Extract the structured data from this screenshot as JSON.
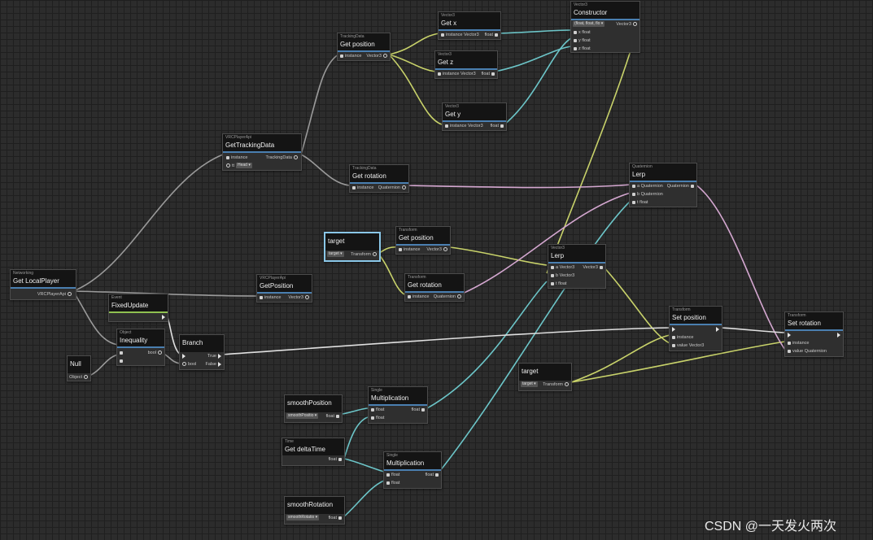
{
  "nodes": {
    "get_local_player": {
      "category": "Networking",
      "title": "Get LocalPlayer",
      "out": "VRCPlayerApi"
    },
    "get_tracking_data": {
      "category": "VRCPlayerApi",
      "title": "GetTrackingData",
      "in1": "instance",
      "in2": "tt",
      "dropdown": "Head",
      "out": "TrackingData"
    },
    "get_position_tracking": {
      "category": "TrackingData",
      "title": "Get position",
      "in": "instance",
      "out": "Vector3"
    },
    "get_x": {
      "category": "Vector3",
      "title": "Get x",
      "in": "instance",
      "in_type": "Vector3",
      "out": "float"
    },
    "get_z": {
      "category": "Vector3",
      "title": "Get z",
      "in": "instance",
      "in_type": "Vector3",
      "out": "float"
    },
    "get_y": {
      "category": "Vector3",
      "title": "Get y",
      "in": "instance",
      "in_type": "Vector3",
      "out": "float"
    },
    "constructor": {
      "category": "Vector3",
      "title": "Constructor",
      "dropdown": "(float, float, flo",
      "out": "Vector3",
      "in_x": "x",
      "in_y": "y",
      "in_z": "z",
      "type": "float"
    },
    "get_rotation_tracking": {
      "category": "TrackingData",
      "title": "Get rotation",
      "in": "instance",
      "out": "Quaternion"
    },
    "quat_lerp": {
      "category": "Quaternion",
      "title": "Lerp",
      "out": "Quaternion",
      "in_a": "a",
      "in_b": "b",
      "in_t": "t",
      "type_a": "Quaternion",
      "type_b": "Quaternion",
      "type_t": "float"
    },
    "get_position_player": {
      "category": "VRCPlayerApi",
      "title": "GetPosition",
      "in": "instance",
      "out": "Vector3"
    },
    "target_var_1": {
      "title": "target",
      "dropdown": "target",
      "out": "Transform"
    },
    "get_position_transform": {
      "category": "Transform",
      "title": "Get position",
      "in": "instance",
      "out": "Vector3"
    },
    "get_rotation_transform": {
      "category": "Transform",
      "title": "Get rotation",
      "in": "instance",
      "out": "Quaternion"
    },
    "vec_lerp": {
      "category": "Vector3",
      "title": "Lerp",
      "out": "Vector3",
      "in_a": "a",
      "in_b": "b",
      "in_t": "t",
      "type_a": "Vector3",
      "type_b": "Vector3",
      "type_t": "float"
    },
    "fixed_update": {
      "category": "Event",
      "title": "FixedUpdate"
    },
    "inequality": {
      "category": "Object",
      "title": "Inequality",
      "out": "bool"
    },
    "branch": {
      "title": "Branch",
      "in": "bool",
      "out_true": "True",
      "out_false": "False"
    },
    "null_node": {
      "title": "Null",
      "out": "Object"
    },
    "set_position": {
      "category": "Transform",
      "title": "Set position",
      "in1": "instance",
      "in2": "value",
      "in2_type": "Vector3"
    },
    "set_rotation": {
      "category": "Transform",
      "title": "Set rotation",
      "in1": "instance",
      "in2": "value",
      "in2_type": "Quaternion"
    },
    "target_var_2": {
      "title": "target",
      "dropdown": "target",
      "out": "Transform"
    },
    "smooth_position": {
      "title": "smoothPosition",
      "dropdown": "smoothPositio",
      "out": "float"
    },
    "mult_1": {
      "category": "Single",
      "title": "Multiplication",
      "in1": "float",
      "in2": "float",
      "out": "float"
    },
    "delta_time": {
      "category": "Time",
      "title": "Get deltaTime",
      "out": "float"
    },
    "mult_2": {
      "category": "Single",
      "title": "Multiplication",
      "in1": "float",
      "in2": "float",
      "out": "float"
    },
    "smooth_rotation": {
      "title": "smoothRotation",
      "dropdown": "smoothRotatio",
      "out": "float"
    }
  },
  "colors": {
    "vector3": "#c8d26a",
    "float": "#6cc5c8",
    "quaternion": "#d4a7d0",
    "object": "#9a9a9a",
    "flow": "#e0e0e0",
    "accent_blue": "#4a7fb0",
    "accent_green": "#8fc050"
  },
  "watermark": "CSDN @一天发火两次"
}
